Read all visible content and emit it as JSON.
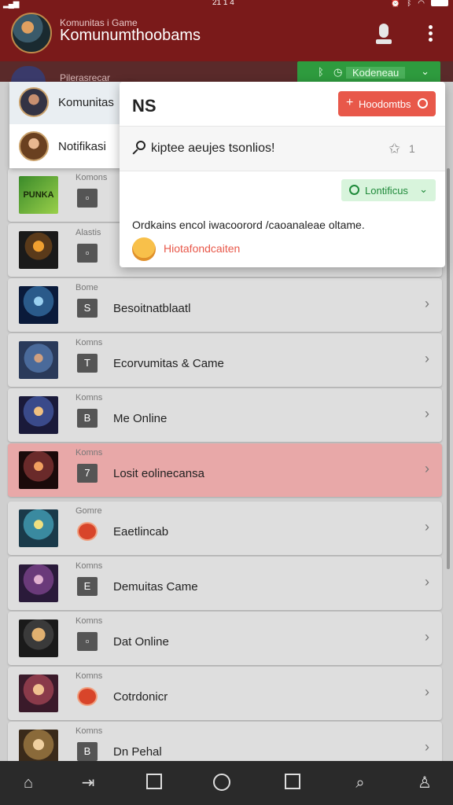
{
  "status_bar": {
    "time": "21 1 4"
  },
  "app_bar": {
    "subtitle": "Komunitas i Game",
    "title": "Komunumthoobams"
  },
  "strip": {
    "label": "Pilerasrecar",
    "green_pill_label": "Kodeneau"
  },
  "drawer": {
    "items": [
      {
        "label": "Komunitas"
      },
      {
        "label": "Notifikasi"
      }
    ]
  },
  "popup": {
    "title": "NS",
    "action_button": "Hoodomtbs",
    "search_query": "kiptee aeujes tsonlios!",
    "search_count": "1",
    "status_pill": "Lontificus",
    "description": "Ordkains encol iwacoorord /caoanaleae oltame.",
    "warning_text": "Hiotafondcaiten"
  },
  "list": {
    "items": [
      {
        "overline": "Komons",
        "badge": "",
        "name": "",
        "badge_style": "square",
        "highlight": false,
        "thumb_text": "PUNKA"
      },
      {
        "overline": "Alastis",
        "badge": "",
        "name": "",
        "badge_style": "square",
        "highlight": false
      },
      {
        "overline": "Bome",
        "badge": "S",
        "name": "Besoitnatblaatl",
        "badge_style": "square",
        "highlight": false
      },
      {
        "overline": "Komns",
        "badge": "T",
        "name": "Ecorvumitas & Came",
        "badge_style": "square",
        "highlight": false
      },
      {
        "overline": "Komns",
        "badge": "B",
        "name": "Me Online",
        "badge_style": "square",
        "highlight": false
      },
      {
        "overline": "Komns",
        "badge": "7",
        "name": "Losit eolinecansa",
        "badge_style": "square",
        "highlight": true
      },
      {
        "overline": "Gomre",
        "badge": "",
        "name": "Eaetlincab",
        "badge_style": "circle",
        "highlight": false
      },
      {
        "overline": "Komns",
        "badge": "E",
        "name": "Demuitas Came",
        "badge_style": "square",
        "highlight": false
      },
      {
        "overline": "Komns",
        "badge": "",
        "name": "Dat Online",
        "badge_style": "square",
        "highlight": false
      },
      {
        "overline": "Komns",
        "badge": "",
        "name": "Cotrdonicr",
        "badge_style": "circle",
        "highlight": false
      },
      {
        "overline": "Komns",
        "badge": "B",
        "name": "Dn Pehal",
        "badge_style": "square",
        "highlight": false
      }
    ]
  },
  "bottom_nav": {
    "items": [
      "home-icon",
      "forward-icon",
      "book-icon",
      "circle-icon",
      "square-icon",
      "search-icon",
      "profile-icon"
    ]
  },
  "colors": {
    "header": "#7a1a1a",
    "accent_red": "#e8584a",
    "accent_green": "#2e9b3e",
    "highlight_row": "#e8a8a8"
  }
}
